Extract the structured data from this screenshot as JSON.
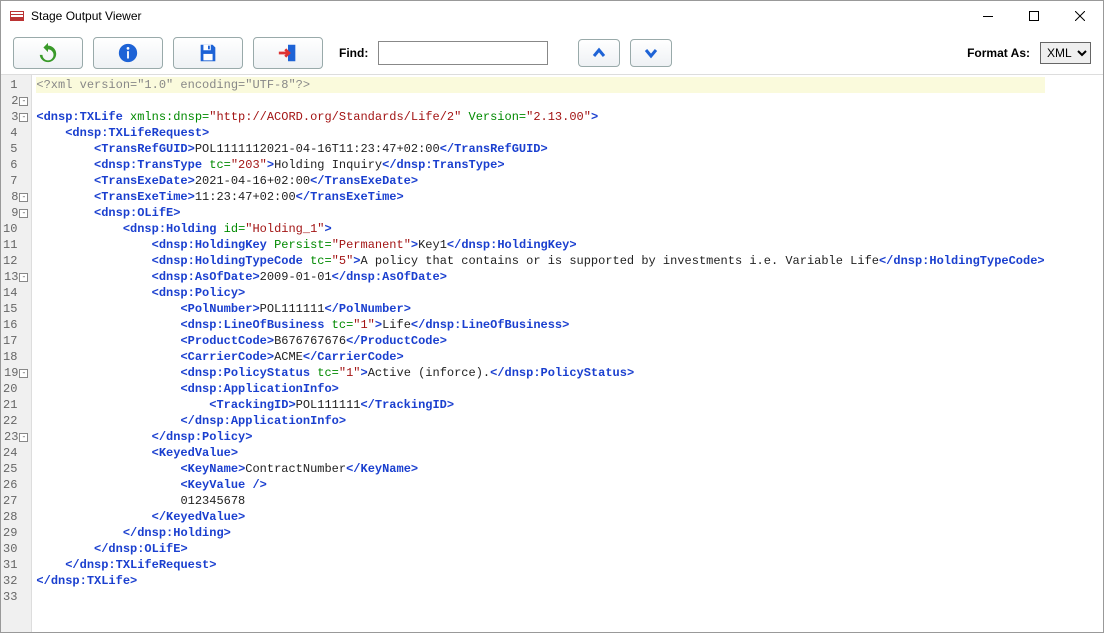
{
  "window": {
    "title": "Stage Output Viewer"
  },
  "toolbar": {
    "find_label": "Find:",
    "find_value": "",
    "format_label": "Format As:",
    "format_selected": "XML"
  },
  "format_options": [
    "XML"
  ],
  "gutter": {
    "lines": 33,
    "fold_lines": [
      2,
      3,
      8,
      9,
      13,
      19,
      23
    ]
  },
  "xml": {
    "decl": "<?xml version=\"1.0\" encoding=\"UTF-8\"?>",
    "root": "dnsp:TXLife",
    "ns_attr": "xmlns:dnsp",
    "ns_val": "http://ACORD.org/Standards/Life/2",
    "ver_attr": "Version",
    "ver_val": "2.13.00",
    "TXLifeRequest": "dnsp:TXLifeRequest",
    "TransRefGUID": {
      "tag": "TransRefGUID",
      "text": "POL1111112021-04-16T11:23:47+02:00"
    },
    "TransType": {
      "tag": "dnsp:TransType",
      "attr": "tc",
      "val": "203",
      "text": "Holding Inquiry"
    },
    "TransExeDate": {
      "tag": "TransExeDate",
      "text": "2021-04-16+02:00"
    },
    "TransExeTime": {
      "tag": "TransExeTime",
      "text": "11:23:47+02:00"
    },
    "OLifE": "dnsp:OLifE",
    "Holding": {
      "tag": "dnsp:Holding",
      "attr": "id",
      "val": "Holding_1"
    },
    "HoldingKey": {
      "tag": "dnsp:HoldingKey",
      "attr": "Persist",
      "val": "Permanent",
      "text": "Key1"
    },
    "HoldingTypeCode": {
      "tag": "dnsp:HoldingTypeCode",
      "attr": "tc",
      "val": "5",
      "text": "A policy that contains or is supported by investments i.e. Variable Life"
    },
    "AsOfDate": {
      "tag": "dnsp:AsOfDate",
      "text": "2009-01-01"
    },
    "Policy": "dnsp:Policy",
    "PolNumber": {
      "tag": "PolNumber",
      "text": "POL111111"
    },
    "LineOfBusiness": {
      "tag": "dnsp:LineOfBusiness",
      "attr": "tc",
      "val": "1",
      "text": "Life"
    },
    "ProductCode": {
      "tag": "ProductCode",
      "text": "B676767676"
    },
    "CarrierCode": {
      "tag": "CarrierCode",
      "text": "ACME"
    },
    "PolicyStatus": {
      "tag": "dnsp:PolicyStatus",
      "attr": "tc",
      "val": "1",
      "text": "Active (inforce)."
    },
    "ApplicationInfo": "dnsp:ApplicationInfo",
    "TrackingID": {
      "tag": "TrackingID",
      "text": "POL111111"
    },
    "KeyedValue": "KeyedValue",
    "KeyName": {
      "tag": "KeyName",
      "text": "ContractNumber"
    },
    "KeyValue": {
      "tag": "KeyValue"
    },
    "KV_text": "012345678"
  }
}
